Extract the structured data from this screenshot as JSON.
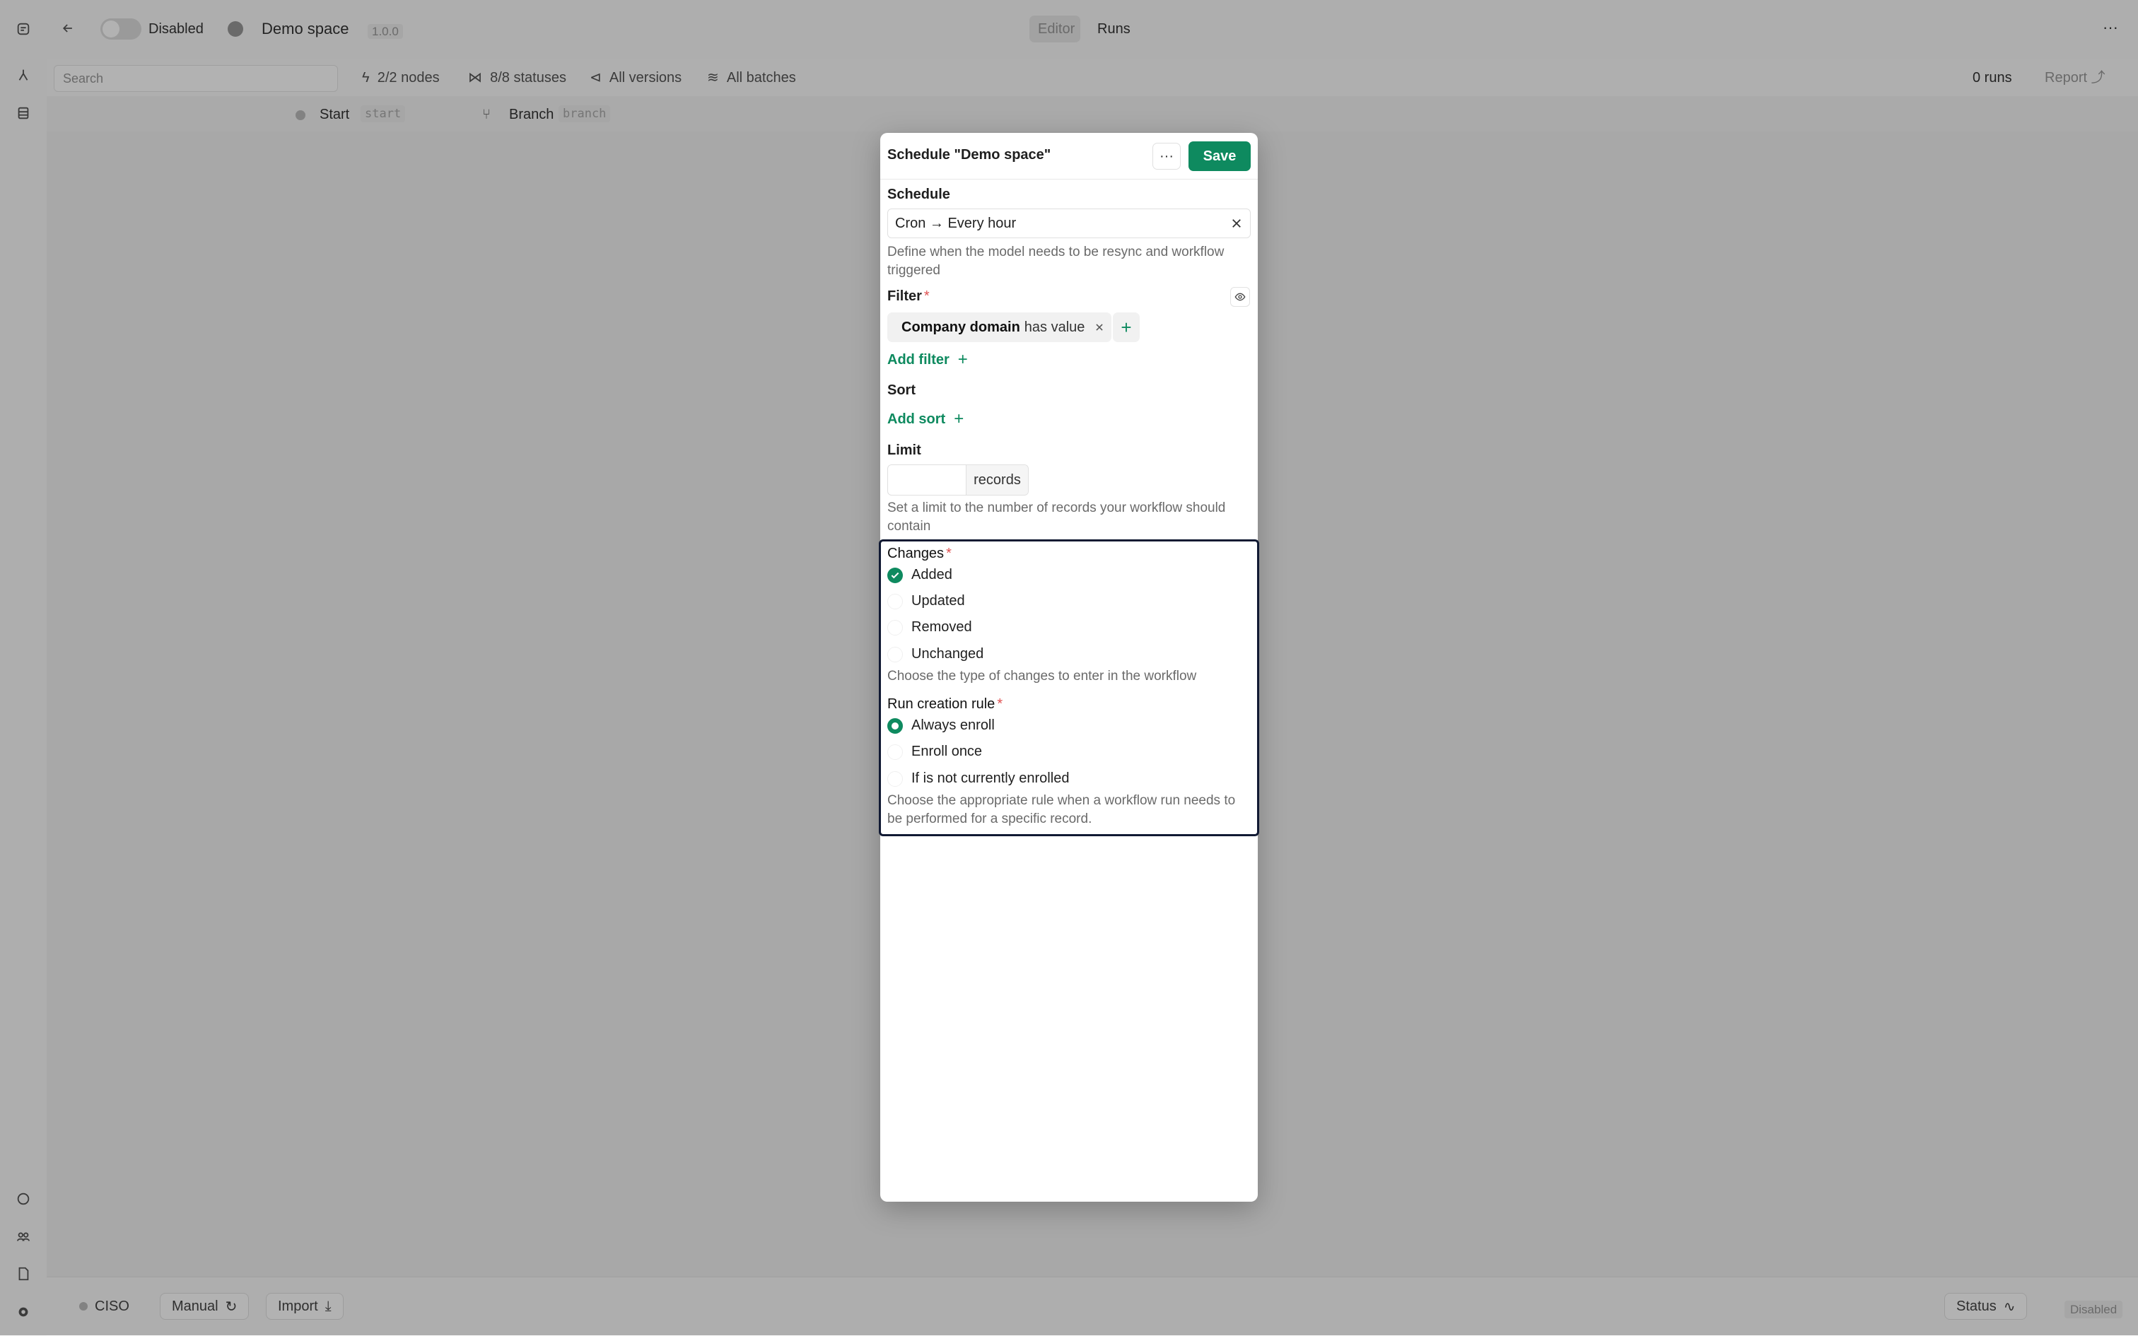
{
  "topbar": {
    "status_label": "Disabled",
    "space_name": "Demo space",
    "version": "1.0.0",
    "tabs": [
      {
        "label": "Editor"
      },
      {
        "label": "Runs"
      }
    ]
  },
  "subbar": {
    "search_placeholder": "Search",
    "nodes": "2/2 nodes",
    "statuses": "8/8 statuses",
    "versions": "All versions",
    "batches": "All batches",
    "runs": "0 runs",
    "report": "Report"
  },
  "nodebar": {
    "nodes": [
      {
        "label": "Start",
        "key": "start"
      },
      {
        "label": "Branch",
        "key": "branch"
      }
    ]
  },
  "bottombar": {
    "ciso": "CISO",
    "manual": "Manual",
    "import": "Import",
    "status": "Status",
    "status_value": "Disabled"
  },
  "modal": {
    "title": "Schedule \"Demo space\"",
    "save_label": "Save",
    "more_label": "···",
    "schedule": {
      "label": "Schedule",
      "value": "Cron → Every hour",
      "help": "Define when the model needs to be resync and workflow triggered"
    },
    "filter": {
      "label": "Filter",
      "required": "*",
      "chip_field": "Company domain",
      "chip_op": "has value",
      "add_label": "Add filter"
    },
    "sort": {
      "label": "Sort",
      "add_label": "Add sort"
    },
    "limit": {
      "label": "Limit",
      "value": "",
      "suffix": "records",
      "help": "Set a limit to the number of records your workflow should contain"
    },
    "changes": {
      "label": "Changes",
      "required": "*",
      "options": [
        {
          "label": "Added",
          "checked": true
        },
        {
          "label": "Updated",
          "checked": false
        },
        {
          "label": "Removed",
          "checked": false
        },
        {
          "label": "Unchanged",
          "checked": false
        }
      ],
      "help": "Choose the type of changes to enter in the workflow"
    },
    "run_rule": {
      "label": "Run creation rule",
      "required": "*",
      "options": [
        {
          "label": "Always enroll",
          "selected": true
        },
        {
          "label": "Enroll once",
          "selected": false
        },
        {
          "label": "If is not currently enrolled",
          "selected": false
        }
      ],
      "help": "Choose the appropriate rule when a workflow run needs to be performed for a specific record."
    }
  },
  "colors": {
    "accent": "#0e8a5f",
    "focus_border": "#111a33"
  }
}
